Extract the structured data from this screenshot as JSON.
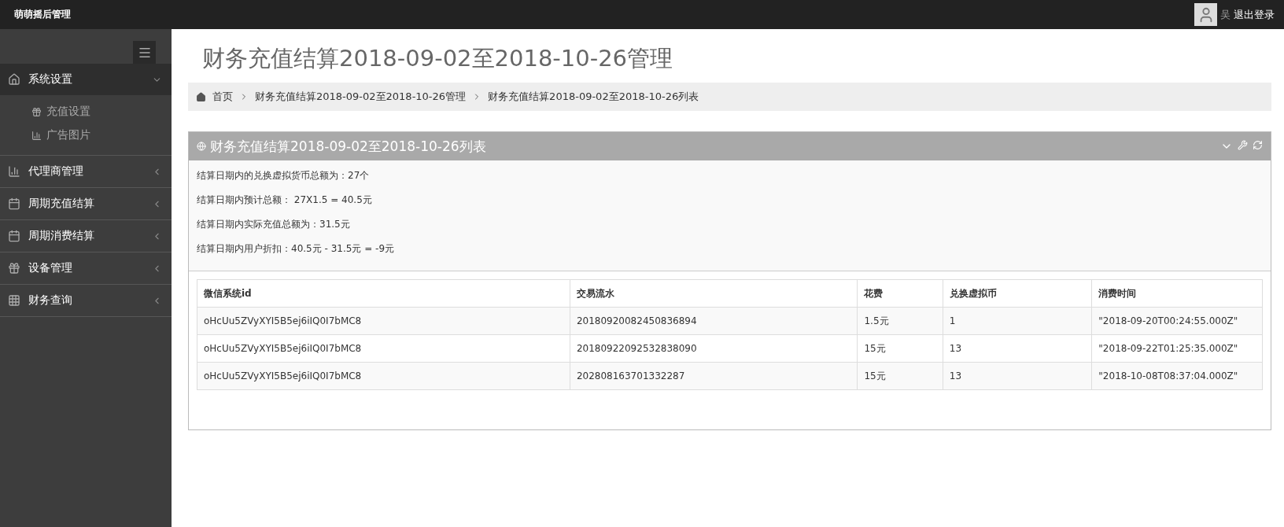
{
  "topbar": {
    "brand": "萌萌摇后管理",
    "user_name": "吴",
    "logout": "退出登录"
  },
  "sidebar": {
    "items": [
      {
        "label": "系统设置",
        "expanded": true,
        "children": [
          {
            "label": "充值设置"
          },
          {
            "label": "广告图片"
          }
        ]
      },
      {
        "label": "代理商管理",
        "expanded": false
      },
      {
        "label": "周期充值结算",
        "expanded": false
      },
      {
        "label": "周期消费结算",
        "expanded": false
      },
      {
        "label": "设备管理",
        "expanded": false
      },
      {
        "label": "财务查询",
        "expanded": false
      }
    ]
  },
  "page_title": "财务充值结算2018-09-02至2018-10-26管理",
  "breadcrumb": [
    "首页",
    "财务充值结算2018-09-02至2018-10-26管理",
    "财务充值结算2018-09-02至2018-10-26列表"
  ],
  "panel": {
    "title": "财务充值结算2018-09-02至2018-10-26列表",
    "summary": [
      "结算日期内的兑换虚拟货币总额为：27个",
      "结算日期内预计总额： 27X1.5 = 40.5元",
      "结算日期内实际充值总额为：31.5元",
      "结算日期内用户折扣：40.5元 - 31.5元 = -9元"
    ],
    "table": {
      "columns": [
        "微信系统id",
        "交易流水",
        "花费",
        "兑换虚拟币",
        "消费时间"
      ],
      "rows": [
        [
          "oHcUu5ZVyXYI5B5ej6iIQ0I7bMC8",
          "20180920082450836894",
          "1.5元",
          "1",
          "\"2018-09-20T00:24:55.000Z\""
        ],
        [
          "oHcUu5ZVyXYI5B5ej6iIQ0I7bMC8",
          "20180922092532838090",
          "15元",
          "13",
          "\"2018-09-22T01:25:35.000Z\""
        ],
        [
          "oHcUu5ZVyXYI5B5ej6iIQ0I7bMC8",
          "202808163701332287",
          "15元",
          "13",
          "\"2018-10-08T08:37:04.000Z\""
        ]
      ]
    }
  }
}
